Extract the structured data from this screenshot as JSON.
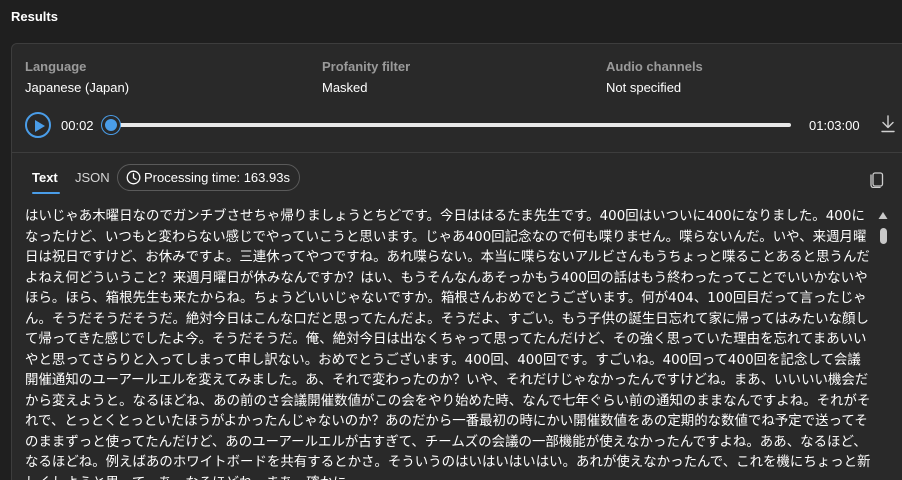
{
  "header": {
    "title": "Results"
  },
  "meta": {
    "language_label": "Language",
    "language_value": "Japanese (Japan)",
    "profanity_label": "Profanity filter",
    "profanity_value": "Masked",
    "audio_label": "Audio channels",
    "audio_value": "Not specified"
  },
  "player": {
    "current_time": "00:02",
    "total_time": "01:03:00",
    "progress_fraction": 0.0005
  },
  "tabs": [
    {
      "label": "Text",
      "selected": true
    },
    {
      "label": "JSON",
      "selected": false
    }
  ],
  "processing_time": "Processing time: 163.93s",
  "transcript": "はいじゃあ木曜日なのでガンチブさせちゃ帰りましょうとちどです。今日ははるたま先生です。400回はいついに400になりました。400になったけど、いつもと変わらない感じでやっていこうと思います。じゃあ400回記念なので何も喋りません。喋らないんだ。いや、来週月曜日は祝日ですけど、お休みですよ。三連休ってやつですね。あれ喋らない。本当に喋らないアルビさんもうちょっと喋ることあると思うんだよねえ何どういうこと？来週月曜日が休みなんですか？はい、もうそんなんあそっかもう400回の話はもう終わったってことでいいかないやほら。ほら、箱根先生も来たからね。ちょうどいいじゃないですか。箱根さんおめでとうございます。何が404、100回目だって言ったじゃん。そうだそうだそうだ。絶対今日はこんな口だと思ってたんだよ。そうだよ、すごい。もう子供の誕生日忘れて家に帰ってはみたいな顔して帰ってきた感じでしたよ今。そうだそうだ。俺、絶対今日は出なくちゃって思ってたんだけど、その強く思っていた理由を忘れてまあいいやと思ってさらりと入ってしまって申し訳ない。おめでとうございます。400回、400回です。すごいね。400回って400回を記念して会議開催通知のユーアールエルを変えてみました。あ、それで変わったのか？いや、それだけじゃなかったんですけどね。まあ、いいいい機会だから変えようと。なるほどね、あの前のさ会議開催数値がこの会をやり始めた時、なんで七年ぐらい前の通知のままなんですよね。それがそれで、とっとくとっといたほうがよかったんじゃないのか？あのだから一番最初の時にかい開催数値をあの定期的な数値でね予定で送ってそのままずっと使ってたんだけど、あのユーアールエルが古すぎて、チームズの会議の一部機能が使えなかったんですよね。ああ、なるほど、なるほどね。例えばあのホワイトボードを共有するとかさ。そういうのはいはいはいはい。あれが使えなかったんで、これを機にちょっと新しくしようと思って。あ、なるほどね。まあ、確かに"
}
